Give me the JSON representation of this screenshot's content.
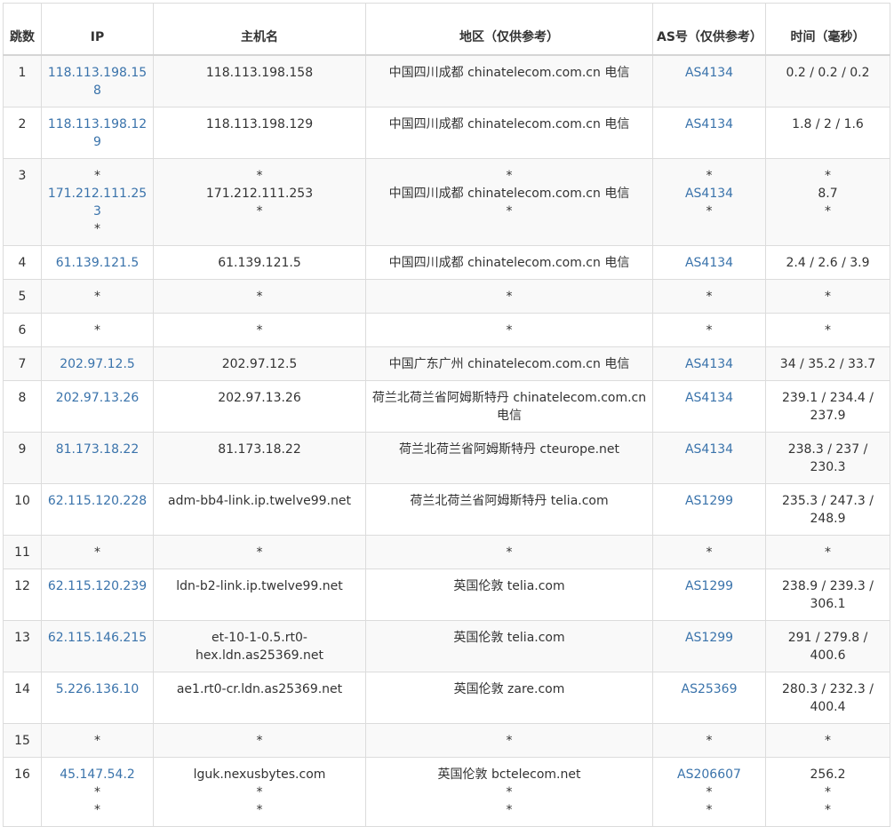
{
  "headers": {
    "hop": "跳数",
    "ip": "IP",
    "host": "主机名",
    "region": "地区（仅供参考）",
    "as": "AS号（仅供参考）",
    "time": "时间（毫秒）"
  },
  "rows": [
    {
      "hop": "1",
      "ip": [
        "118.113.198.158"
      ],
      "host": [
        "118.113.198.158"
      ],
      "region": [
        "中国四川成都 chinatelecom.com.cn 电信"
      ],
      "as": [
        "AS4134"
      ],
      "time": [
        "0.2 / 0.2 / 0.2"
      ],
      "h": "h1"
    },
    {
      "hop": "2",
      "ip": [
        "118.113.198.129"
      ],
      "host": [
        "118.113.198.129"
      ],
      "region": [
        "中国四川成都 chinatelecom.com.cn 电信"
      ],
      "as": [
        "AS4134"
      ],
      "time": [
        "1.8 / 2 / 1.6"
      ],
      "h": "h1"
    },
    {
      "hop": "3",
      "ip": [
        "*",
        "171.212.111.253",
        "*"
      ],
      "host": [
        "*",
        "171.212.111.253",
        "*"
      ],
      "region": [
        "*",
        "中国四川成都 chinatelecom.com.cn 电信",
        "*"
      ],
      "as": [
        "*",
        "AS4134",
        "*"
      ],
      "time": [
        "*",
        "8.7",
        "*"
      ],
      "h": "h3"
    },
    {
      "hop": "4",
      "ip": [
        "61.139.121.5"
      ],
      "host": [
        "61.139.121.5"
      ],
      "region": [
        "中国四川成都 chinatelecom.com.cn 电信"
      ],
      "as": [
        "AS4134"
      ],
      "time": [
        "2.4 / 2.6 / 3.9"
      ],
      "h": "h1"
    },
    {
      "hop": "5",
      "ip": [
        "*"
      ],
      "host": [
        "*"
      ],
      "region": [
        "*"
      ],
      "as": [
        "*"
      ],
      "time": [
        "*"
      ],
      "h": "h1"
    },
    {
      "hop": "6",
      "ip": [
        "*"
      ],
      "host": [
        "*"
      ],
      "region": [
        "*"
      ],
      "as": [
        "*"
      ],
      "time": [
        "*"
      ],
      "h": "h1"
    },
    {
      "hop": "7",
      "ip": [
        "202.97.12.5"
      ],
      "host": [
        "202.97.12.5"
      ],
      "region": [
        "中国广东广州 chinatelecom.com.cn 电信"
      ],
      "as": [
        "AS4134"
      ],
      "time": [
        "34 / 35.2 / 33.7"
      ],
      "h": "h1"
    },
    {
      "hop": "8",
      "ip": [
        "202.97.13.26"
      ],
      "host": [
        "202.97.13.26"
      ],
      "region": [
        "荷兰北荷兰省阿姆斯特丹 chinatelecom.com.cn 电信"
      ],
      "as": [
        "AS4134"
      ],
      "time": [
        "239.1 / 234.4 / 237.9"
      ],
      "h": "h2"
    },
    {
      "hop": "9",
      "ip": [
        "81.173.18.22"
      ],
      "host": [
        "81.173.18.22"
      ],
      "region": [
        "荷兰北荷兰省阿姆斯特丹 cteurope.net"
      ],
      "as": [
        "AS4134"
      ],
      "time": [
        "238.3 / 237 / 230.3"
      ],
      "h": "h2"
    },
    {
      "hop": "10",
      "ip": [
        "62.115.120.228"
      ],
      "host": [
        "adm-bb4-link.ip.twelve99.net"
      ],
      "region": [
        "荷兰北荷兰省阿姆斯特丹 telia.com"
      ],
      "as": [
        "AS1299"
      ],
      "time": [
        "235.3 / 247.3 / 248.9"
      ],
      "h": "h2"
    },
    {
      "hop": "11",
      "ip": [
        "*"
      ],
      "host": [
        "*"
      ],
      "region": [
        "*"
      ],
      "as": [
        "*"
      ],
      "time": [
        "*"
      ],
      "h": "h1"
    },
    {
      "hop": "12",
      "ip": [
        "62.115.120.239"
      ],
      "host": [
        "ldn-b2-link.ip.twelve99.net"
      ],
      "region": [
        "英国伦敦 telia.com"
      ],
      "as": [
        "AS1299"
      ],
      "time": [
        "238.9 / 239.3 / 306.1"
      ],
      "h": "h2"
    },
    {
      "hop": "13",
      "ip": [
        "62.115.146.215"
      ],
      "host": [
        "et-10-1-0.5.rt0-hex.ldn.as25369.net"
      ],
      "region": [
        "英国伦敦 telia.com"
      ],
      "as": [
        "AS1299"
      ],
      "time": [
        "291 / 279.8 / 400.6"
      ],
      "h": "h2"
    },
    {
      "hop": "14",
      "ip": [
        "5.226.136.10"
      ],
      "host": [
        "ae1.rt0-cr.ldn.as25369.net"
      ],
      "region": [
        "英国伦敦 zare.com"
      ],
      "as": [
        "AS25369"
      ],
      "time": [
        "280.3 / 232.3 / 400.4"
      ],
      "h": "h2"
    },
    {
      "hop": "15",
      "ip": [
        "*"
      ],
      "host": [
        "*"
      ],
      "region": [
        "*"
      ],
      "as": [
        "*"
      ],
      "time": [
        "*"
      ],
      "h": "h1"
    },
    {
      "hop": "16",
      "ip": [
        "45.147.54.2",
        "*",
        "*"
      ],
      "host": [
        "lguk.nexusbytes.com",
        "*",
        "*"
      ],
      "region": [
        "英国伦敦 bctelecom.net",
        "*",
        "*"
      ],
      "as": [
        "AS206607",
        "*",
        "*"
      ],
      "time": [
        "256.2",
        "*",
        "*"
      ],
      "h": "h3"
    }
  ],
  "colors": {
    "link": "#3a73ab",
    "border": "#dcdcdc",
    "stripe": "#f9f9f9"
  }
}
